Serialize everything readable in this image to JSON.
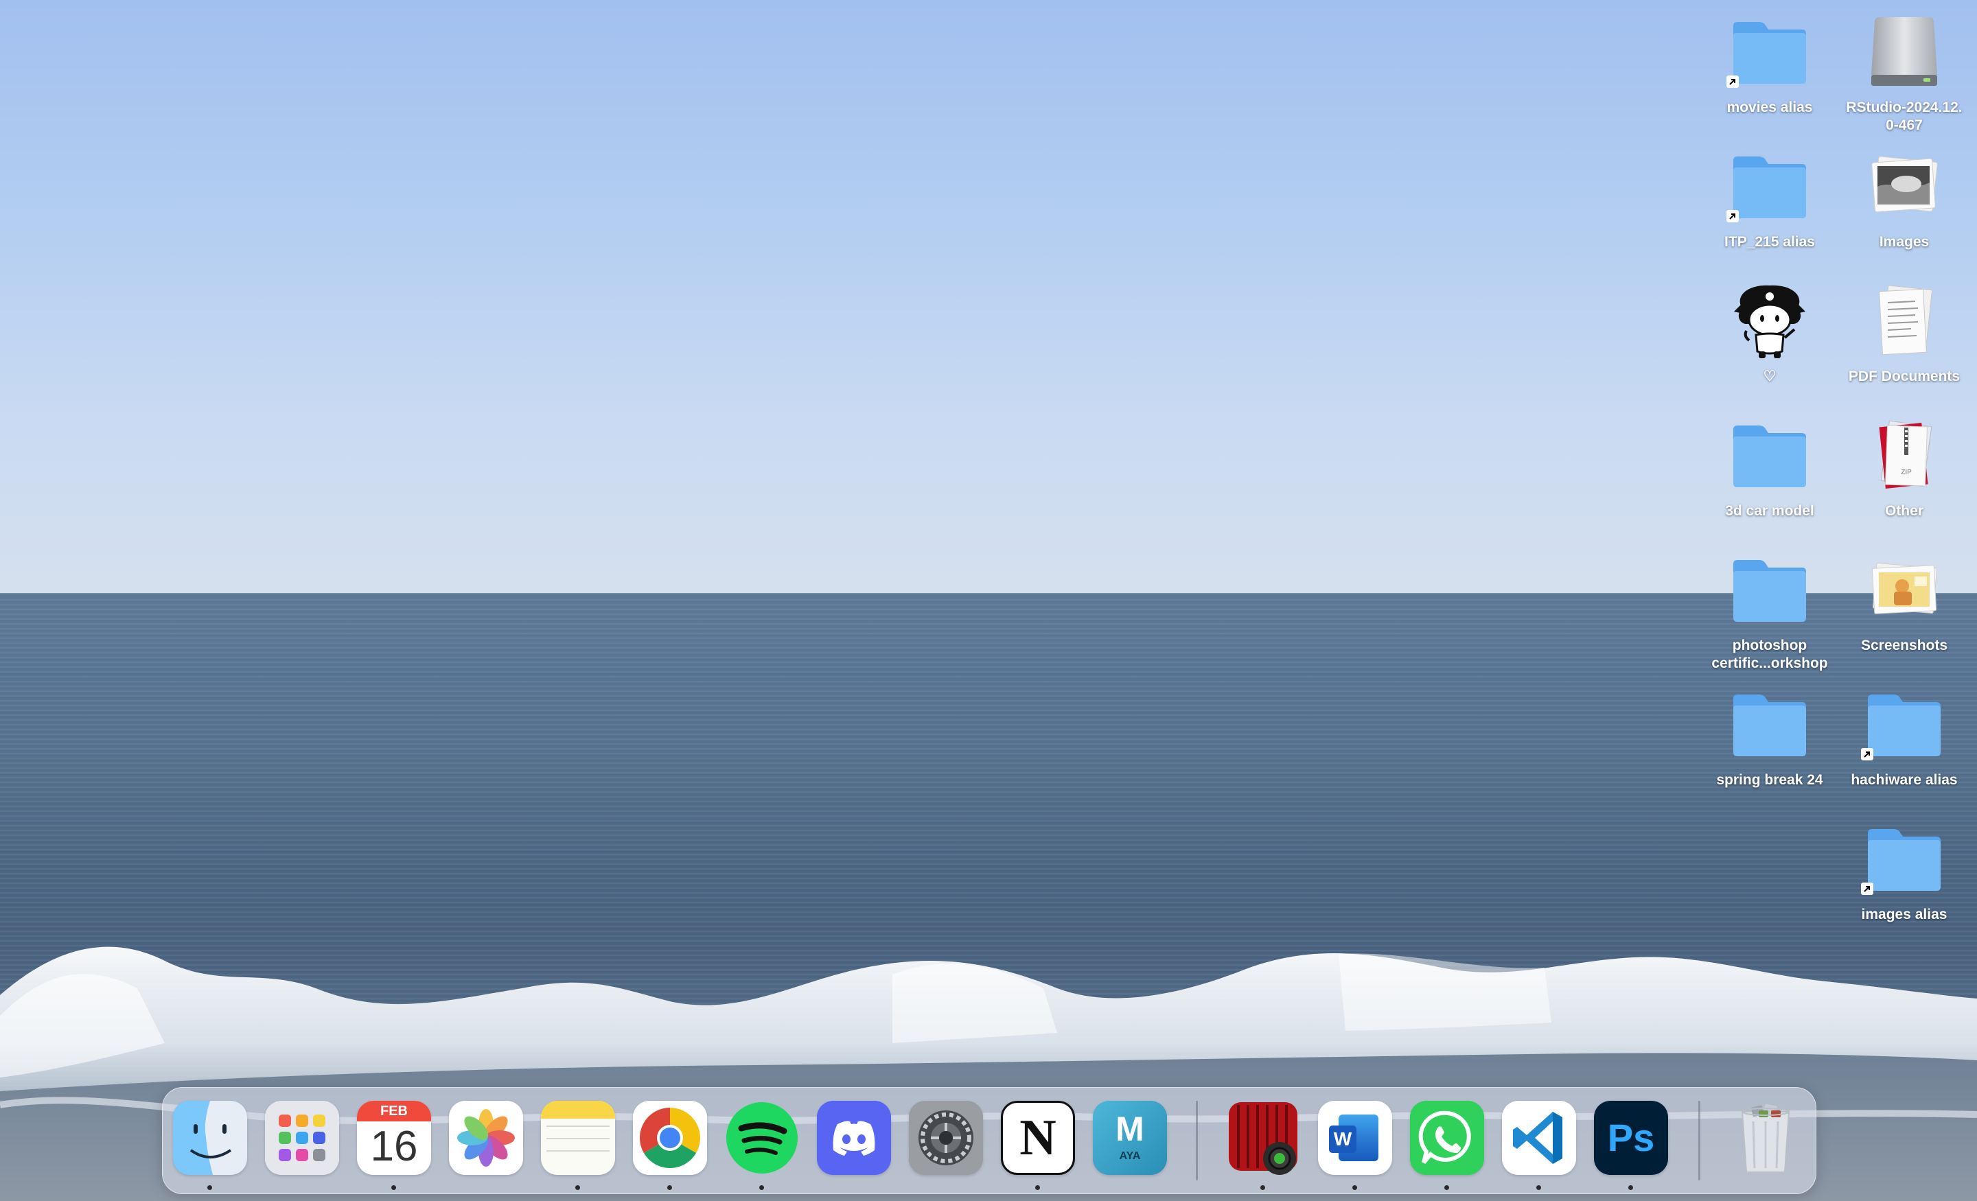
{
  "desktop": {
    "icons": [
      {
        "label": "movies alias",
        "type": "folder",
        "alias": true
      },
      {
        "label": "RStudio-2024.12.\n0-467",
        "type": "disk"
      },
      {
        "label": "ITP_215 alias",
        "type": "folder",
        "alias": true
      },
      {
        "label": "Images",
        "type": "photo-stack"
      },
      {
        "label": "♡",
        "type": "sticker"
      },
      {
        "label": "PDF Documents",
        "type": "document-stack"
      },
      {
        "label": "3d car model",
        "type": "folder"
      },
      {
        "label": "Other",
        "type": "zip-stack"
      },
      {
        "label": "photoshop\ncertific...orkshop",
        "type": "folder"
      },
      {
        "label": "Screenshots",
        "type": "screenshot-stack"
      },
      {
        "label": "spring break 24",
        "type": "folder"
      },
      {
        "label": "hachiware alias",
        "type": "folder",
        "alias": true
      },
      {
        "label": "images alias",
        "type": "folder",
        "alias": true
      }
    ]
  },
  "dock": {
    "calendar": {
      "month": "FEB",
      "day": "16"
    },
    "maya_letter": "M",
    "maya_sub": "AYA",
    "word_letter": "W",
    "ps_letter": "Ps",
    "notion_letter": "N",
    "apps": [
      {
        "name": "Finder",
        "icon": "finder-icon",
        "running": true
      },
      {
        "name": "Launchpad",
        "icon": "launchpad-icon",
        "running": false
      },
      {
        "name": "Calendar",
        "icon": "calendar-icon",
        "running": true
      },
      {
        "name": "Photos",
        "icon": "photos-icon",
        "running": false
      },
      {
        "name": "Notes",
        "icon": "notes-icon",
        "running": true
      },
      {
        "name": "Google Chrome",
        "icon": "chrome-icon",
        "running": true
      },
      {
        "name": "Spotify",
        "icon": "spotify-icon",
        "running": true
      },
      {
        "name": "Discord",
        "icon": "discord-icon",
        "running": false
      },
      {
        "name": "System Settings",
        "icon": "settings-icon",
        "running": false
      },
      {
        "name": "Notion",
        "icon": "notion-icon",
        "running": true
      },
      {
        "name": "Maya",
        "icon": "maya-icon",
        "running": false
      },
      {
        "name": "Photo Booth",
        "icon": "photo-booth-icon",
        "running": true
      },
      {
        "name": "Microsoft Word",
        "icon": "word-icon",
        "running": true
      },
      {
        "name": "WhatsApp",
        "icon": "whatsapp-icon",
        "running": true
      },
      {
        "name": "Visual Studio Code",
        "icon": "vscode-icon",
        "running": true
      },
      {
        "name": "Photoshop",
        "icon": "photoshop-icon",
        "running": true
      },
      {
        "name": "Trash",
        "icon": "trash-icon",
        "running": false
      }
    ]
  },
  "colors": {
    "folder": "#6fb5f4",
    "folder_tab": "#5aa6ee",
    "sky_top": "#a2c0ef",
    "sea": "#4c6684"
  }
}
